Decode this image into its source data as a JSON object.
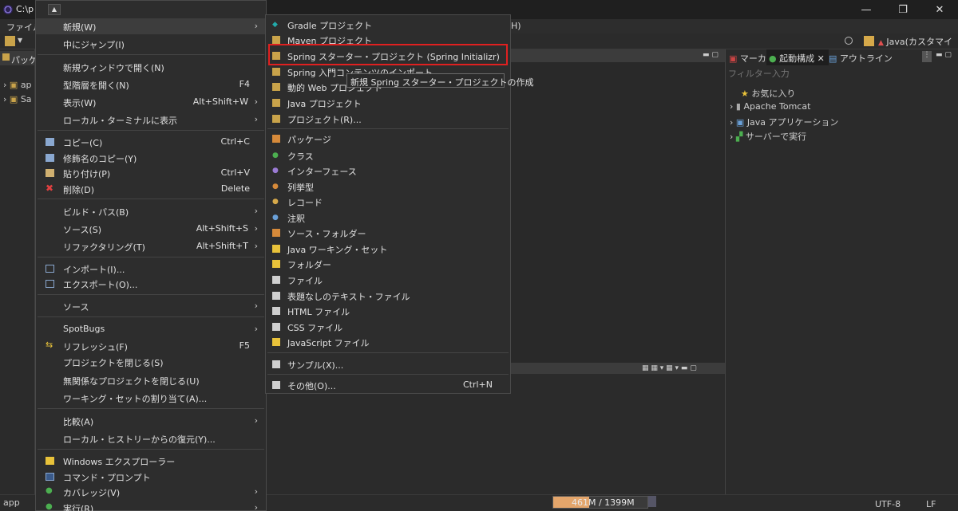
{
  "window": {
    "title": "C:\\p",
    "minimize": "—",
    "maximize": "❐",
    "close": "✕"
  },
  "menubar": {
    "file": "ファイル(",
    "help": "H)"
  },
  "toolbar": {
    "perspective": "Java(カスタマイズ)"
  },
  "left_panel": {
    "tab": "パッケ",
    "items": [
      {
        "label": "ap"
      },
      {
        "label": "Sa"
      }
    ]
  },
  "right_panel": {
    "tabs": [
      {
        "label": "マーカー"
      },
      {
        "label": "起動構成"
      },
      {
        "label": "アウトライン"
      }
    ],
    "filter_placeholder": "フィルター入力",
    "tree": [
      {
        "label": "お気に入り"
      },
      {
        "label": "Apache Tomcat"
      },
      {
        "label": "Java アプリケーション"
      },
      {
        "label": "サーバーで実行"
      }
    ]
  },
  "status": {
    "left": "app",
    "heap": "461M / 1399M",
    "encoding": "UTF-8",
    "line_sep": "LF"
  },
  "context_menu": {
    "scroll_up": "▲",
    "items": [
      {
        "label": "新規(W)",
        "accel": "",
        "arrow": "›"
      },
      {
        "label": "中にジャンプ(I)",
        "accel": "",
        "arrow": ""
      },
      {
        "label": "新規ウィンドウで開く(N)",
        "accel": "",
        "arrow": ""
      },
      {
        "label": "型階層を開く(N)",
        "accel": "F4",
        "arrow": ""
      },
      {
        "label": "表示(W)",
        "accel": "Alt+Shift+W",
        "arrow": "›"
      },
      {
        "label": "ローカル・ターミナルに表示",
        "accel": "",
        "arrow": "›"
      },
      {
        "label": "コピー(C)",
        "accel": "Ctrl+C",
        "arrow": ""
      },
      {
        "label": "修飾名のコピー(Y)",
        "accel": "",
        "arrow": ""
      },
      {
        "label": "貼り付け(P)",
        "accel": "Ctrl+V",
        "arrow": ""
      },
      {
        "label": "削除(D)",
        "accel": "Delete",
        "arrow": ""
      },
      {
        "label": "ビルド・パス(B)",
        "accel": "",
        "arrow": "›"
      },
      {
        "label": "ソース(S)",
        "accel": "Alt+Shift+S",
        "arrow": "›"
      },
      {
        "label": "リファクタリング(T)",
        "accel": "Alt+Shift+T",
        "arrow": "›"
      },
      {
        "label": "インポート(I)...",
        "accel": "",
        "arrow": ""
      },
      {
        "label": "エクスポート(O)...",
        "accel": "",
        "arrow": ""
      },
      {
        "label": "ソース",
        "accel": "",
        "arrow": "›"
      },
      {
        "label": "SpotBugs",
        "accel": "",
        "arrow": "›"
      },
      {
        "label": "リフレッシュ(F)",
        "accel": "F5",
        "arrow": ""
      },
      {
        "label": "プロジェクトを閉じる(S)",
        "accel": "",
        "arrow": ""
      },
      {
        "label": "無関係なプロジェクトを閉じる(U)",
        "accel": "",
        "arrow": ""
      },
      {
        "label": "ワーキング・セットの割り当て(A)...",
        "accel": "",
        "arrow": ""
      },
      {
        "label": "比較(A)",
        "accel": "",
        "arrow": "›"
      },
      {
        "label": "ローカル・ヒストリーからの復元(Y)...",
        "accel": "",
        "arrow": ""
      },
      {
        "label": "Windows エクスプローラー",
        "accel": "",
        "arrow": ""
      },
      {
        "label": "コマンド・プロンプト",
        "accel": "",
        "arrow": ""
      },
      {
        "label": "カバレッジ(V)",
        "accel": "",
        "arrow": "›"
      },
      {
        "label": "実行(R)",
        "accel": "",
        "arrow": "›"
      }
    ]
  },
  "submenu": {
    "items": [
      {
        "label": "Gradle プロジェクト",
        "accel": ""
      },
      {
        "label": "Maven プロジェクト",
        "accel": ""
      },
      {
        "label": "Spring スターター・プロジェクト (Spring Initializr)",
        "accel": ""
      },
      {
        "label": "Spring 入門コンテンツのインポート",
        "accel": ""
      },
      {
        "label": "動的 Web プロジェクト",
        "accel": ""
      },
      {
        "label": "Java プロジェクト",
        "accel": ""
      },
      {
        "label": "プロジェクト(R)...",
        "accel": ""
      },
      {
        "label": "パッケージ",
        "accel": ""
      },
      {
        "label": "クラス",
        "accel": ""
      },
      {
        "label": "インターフェース",
        "accel": ""
      },
      {
        "label": "列挙型",
        "accel": ""
      },
      {
        "label": "レコード",
        "accel": ""
      },
      {
        "label": "注釈",
        "accel": ""
      },
      {
        "label": "ソース・フォルダー",
        "accel": ""
      },
      {
        "label": "Java ワーキング・セット",
        "accel": ""
      },
      {
        "label": "フォルダー",
        "accel": ""
      },
      {
        "label": "ファイル",
        "accel": ""
      },
      {
        "label": "表題なしのテキスト・ファイル",
        "accel": ""
      },
      {
        "label": "HTML ファイル",
        "accel": ""
      },
      {
        "label": "CSS ファイル",
        "accel": ""
      },
      {
        "label": "JavaScript ファイル",
        "accel": ""
      },
      {
        "label": "サンプル(X)...",
        "accel": ""
      },
      {
        "label": "その他(O)...",
        "accel": "Ctrl+N"
      }
    ]
  },
  "tooltip": "新規 Spring スターター・プロジェクトの作成",
  "colors": {
    "highlight": "#e02020",
    "heap": "#e3a56b"
  }
}
